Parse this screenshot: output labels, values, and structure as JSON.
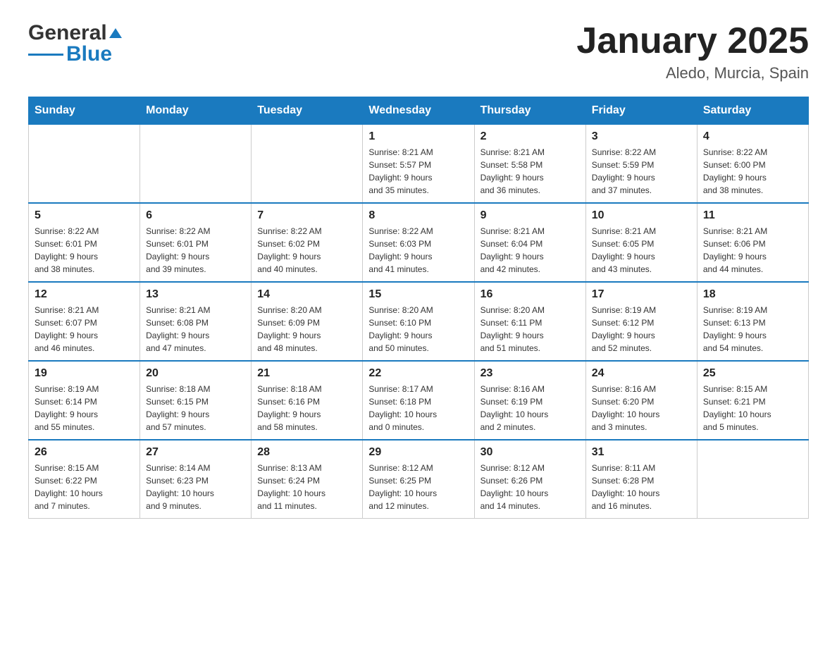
{
  "header": {
    "logo_general": "General",
    "logo_blue": "Blue",
    "calendar_title": "January 2025",
    "calendar_subtitle": "Aledo, Murcia, Spain"
  },
  "days_of_week": [
    "Sunday",
    "Monday",
    "Tuesday",
    "Wednesday",
    "Thursday",
    "Friday",
    "Saturday"
  ],
  "weeks": [
    [
      {
        "day": "",
        "info": ""
      },
      {
        "day": "",
        "info": ""
      },
      {
        "day": "",
        "info": ""
      },
      {
        "day": "1",
        "info": "Sunrise: 8:21 AM\nSunset: 5:57 PM\nDaylight: 9 hours\nand 35 minutes."
      },
      {
        "day": "2",
        "info": "Sunrise: 8:21 AM\nSunset: 5:58 PM\nDaylight: 9 hours\nand 36 minutes."
      },
      {
        "day": "3",
        "info": "Sunrise: 8:22 AM\nSunset: 5:59 PM\nDaylight: 9 hours\nand 37 minutes."
      },
      {
        "day": "4",
        "info": "Sunrise: 8:22 AM\nSunset: 6:00 PM\nDaylight: 9 hours\nand 38 minutes."
      }
    ],
    [
      {
        "day": "5",
        "info": "Sunrise: 8:22 AM\nSunset: 6:01 PM\nDaylight: 9 hours\nand 38 minutes."
      },
      {
        "day": "6",
        "info": "Sunrise: 8:22 AM\nSunset: 6:01 PM\nDaylight: 9 hours\nand 39 minutes."
      },
      {
        "day": "7",
        "info": "Sunrise: 8:22 AM\nSunset: 6:02 PM\nDaylight: 9 hours\nand 40 minutes."
      },
      {
        "day": "8",
        "info": "Sunrise: 8:22 AM\nSunset: 6:03 PM\nDaylight: 9 hours\nand 41 minutes."
      },
      {
        "day": "9",
        "info": "Sunrise: 8:21 AM\nSunset: 6:04 PM\nDaylight: 9 hours\nand 42 minutes."
      },
      {
        "day": "10",
        "info": "Sunrise: 8:21 AM\nSunset: 6:05 PM\nDaylight: 9 hours\nand 43 minutes."
      },
      {
        "day": "11",
        "info": "Sunrise: 8:21 AM\nSunset: 6:06 PM\nDaylight: 9 hours\nand 44 minutes."
      }
    ],
    [
      {
        "day": "12",
        "info": "Sunrise: 8:21 AM\nSunset: 6:07 PM\nDaylight: 9 hours\nand 46 minutes."
      },
      {
        "day": "13",
        "info": "Sunrise: 8:21 AM\nSunset: 6:08 PM\nDaylight: 9 hours\nand 47 minutes."
      },
      {
        "day": "14",
        "info": "Sunrise: 8:20 AM\nSunset: 6:09 PM\nDaylight: 9 hours\nand 48 minutes."
      },
      {
        "day": "15",
        "info": "Sunrise: 8:20 AM\nSunset: 6:10 PM\nDaylight: 9 hours\nand 50 minutes."
      },
      {
        "day": "16",
        "info": "Sunrise: 8:20 AM\nSunset: 6:11 PM\nDaylight: 9 hours\nand 51 minutes."
      },
      {
        "day": "17",
        "info": "Sunrise: 8:19 AM\nSunset: 6:12 PM\nDaylight: 9 hours\nand 52 minutes."
      },
      {
        "day": "18",
        "info": "Sunrise: 8:19 AM\nSunset: 6:13 PM\nDaylight: 9 hours\nand 54 minutes."
      }
    ],
    [
      {
        "day": "19",
        "info": "Sunrise: 8:19 AM\nSunset: 6:14 PM\nDaylight: 9 hours\nand 55 minutes."
      },
      {
        "day": "20",
        "info": "Sunrise: 8:18 AM\nSunset: 6:15 PM\nDaylight: 9 hours\nand 57 minutes."
      },
      {
        "day": "21",
        "info": "Sunrise: 8:18 AM\nSunset: 6:16 PM\nDaylight: 9 hours\nand 58 minutes."
      },
      {
        "day": "22",
        "info": "Sunrise: 8:17 AM\nSunset: 6:18 PM\nDaylight: 10 hours\nand 0 minutes."
      },
      {
        "day": "23",
        "info": "Sunrise: 8:16 AM\nSunset: 6:19 PM\nDaylight: 10 hours\nand 2 minutes."
      },
      {
        "day": "24",
        "info": "Sunrise: 8:16 AM\nSunset: 6:20 PM\nDaylight: 10 hours\nand 3 minutes."
      },
      {
        "day": "25",
        "info": "Sunrise: 8:15 AM\nSunset: 6:21 PM\nDaylight: 10 hours\nand 5 minutes."
      }
    ],
    [
      {
        "day": "26",
        "info": "Sunrise: 8:15 AM\nSunset: 6:22 PM\nDaylight: 10 hours\nand 7 minutes."
      },
      {
        "day": "27",
        "info": "Sunrise: 8:14 AM\nSunset: 6:23 PM\nDaylight: 10 hours\nand 9 minutes."
      },
      {
        "day": "28",
        "info": "Sunrise: 8:13 AM\nSunset: 6:24 PM\nDaylight: 10 hours\nand 11 minutes."
      },
      {
        "day": "29",
        "info": "Sunrise: 8:12 AM\nSunset: 6:25 PM\nDaylight: 10 hours\nand 12 minutes."
      },
      {
        "day": "30",
        "info": "Sunrise: 8:12 AM\nSunset: 6:26 PM\nDaylight: 10 hours\nand 14 minutes."
      },
      {
        "day": "31",
        "info": "Sunrise: 8:11 AM\nSunset: 6:28 PM\nDaylight: 10 hours\nand 16 minutes."
      },
      {
        "day": "",
        "info": ""
      }
    ]
  ]
}
